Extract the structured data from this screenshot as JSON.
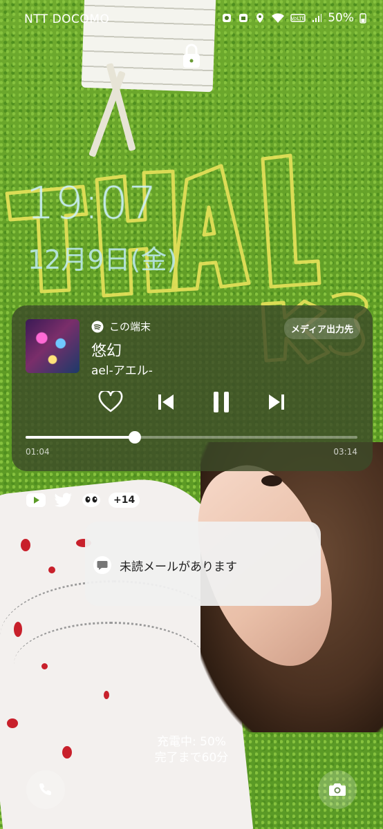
{
  "status_bar": {
    "carrier": "NTT DOCOMO",
    "battery": "50%",
    "icons": [
      "notification-icon",
      "notification-icon-2",
      "location-icon",
      "wifi-icon",
      "volte-icon",
      "signal-icon",
      "battery-icon"
    ]
  },
  "lock": {
    "icon": "lock-icon"
  },
  "clock": {
    "time": "19:07",
    "date": "12月9日(金)"
  },
  "media": {
    "source": "この端末",
    "output_button": "メディア出力先",
    "title": "悠幻",
    "artist": "ael-アエル-",
    "elapsed": "01:04",
    "duration": "03:14",
    "progress": 0.33,
    "controls": [
      "heart-icon",
      "previous-icon",
      "pause-icon",
      "next-icon"
    ]
  },
  "notification_icons": {
    "apps": [
      "youtube-icon",
      "twitter-icon",
      "mail-app-icon"
    ],
    "more": "+14"
  },
  "notification": {
    "text": "未読メールがあります",
    "icon": "message-icon"
  },
  "charging": {
    "line1": "充電中: 50%",
    "line2": "完了まで60分"
  },
  "shortcuts": {
    "left": "phone-icon",
    "right": "camera-icon"
  }
}
